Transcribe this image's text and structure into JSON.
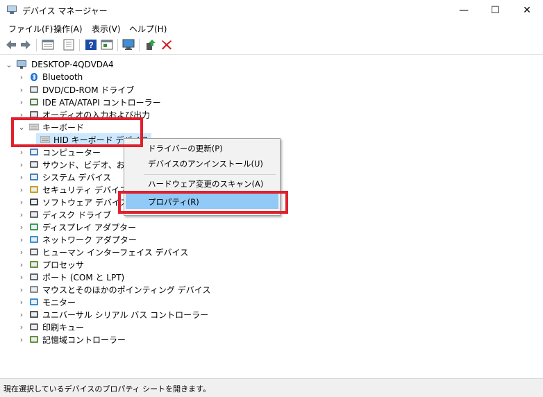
{
  "window": {
    "title": "デバイス マネージャー",
    "minimize": "—",
    "maximize": "☐",
    "close": "✕"
  },
  "menu": [
    "ファイル(F)",
    "操作(A)",
    "表示(V)",
    "ヘルプ(H)"
  ],
  "toolbar": [
    "back-icon",
    "forward-icon",
    "properties-grid-icon",
    "list-icon",
    "help-icon",
    "view-icon",
    "monitor-icon",
    "enable-icon",
    "delete-icon"
  ],
  "tree": {
    "root": "DESKTOP-4QDVDA4",
    "items": [
      {
        "label": "Bluetooth",
        "icon": "bluetooth-icon",
        "expanded": false
      },
      {
        "label": "DVD/CD-ROM ドライブ",
        "icon": "dvd-drive-icon",
        "expanded": false
      },
      {
        "label": "IDE ATA/ATAPI コントローラー",
        "icon": "ide-controller-icon",
        "expanded": false
      },
      {
        "label": "オーディオの入力および出力",
        "icon": "audio-icon",
        "expanded": false
      },
      {
        "label": "キーボード",
        "icon": "keyboard-icon",
        "expanded": true
      },
      {
        "label": "HID キーボード デバイス",
        "icon": "keyboard-icon",
        "child": true
      },
      {
        "label": "コンピューター",
        "icon": "computer-icon",
        "expanded": false
      },
      {
        "label": "サウンド、ビデオ、およびゲーム コントローラー",
        "icon": "sound-icon",
        "expanded": false
      },
      {
        "label": "システム デバイス",
        "icon": "system-device-icon",
        "expanded": false
      },
      {
        "label": "セキュリティ デバイス",
        "icon": "security-icon",
        "expanded": false
      },
      {
        "label": "ソフトウェア デバイス",
        "icon": "software-device-icon",
        "expanded": false
      },
      {
        "label": "ディスク ドライブ",
        "icon": "disk-drive-icon",
        "expanded": false
      },
      {
        "label": "ディスプレイ アダプター",
        "icon": "display-adapter-icon",
        "expanded": false
      },
      {
        "label": "ネットワーク アダプター",
        "icon": "network-adapter-icon",
        "expanded": false
      },
      {
        "label": "ヒューマン インターフェイス デバイス",
        "icon": "hid-icon",
        "expanded": false
      },
      {
        "label": "プロセッサ",
        "icon": "processor-icon",
        "expanded": false
      },
      {
        "label": "ポート (COM と LPT)",
        "icon": "port-icon",
        "expanded": false
      },
      {
        "label": "マウスとそのほかのポインティング デバイス",
        "icon": "mouse-icon",
        "expanded": false
      },
      {
        "label": "モニター",
        "icon": "monitor-icon",
        "expanded": false
      },
      {
        "label": "ユニバーサル シリアル バス コントローラー",
        "icon": "usb-icon",
        "expanded": false
      },
      {
        "label": "印刷キュー",
        "icon": "printer-icon",
        "expanded": false
      },
      {
        "label": "記憶域コントローラー",
        "icon": "storage-controller-icon",
        "expanded": false
      }
    ]
  },
  "context_menu": {
    "items": [
      "ドライバーの更新(P)",
      "デバイスのアンインストール(U)",
      "ハードウェア変更のスキャン(A)",
      "プロパティ(R)"
    ],
    "highlighted": "プロパティ(R)"
  },
  "status": "現在選択しているデバイスのプロパティ シートを開きます。",
  "colors": {
    "highlight": "#91c9f7",
    "annotation": "#e0202d",
    "selection": "#cce8ff"
  }
}
